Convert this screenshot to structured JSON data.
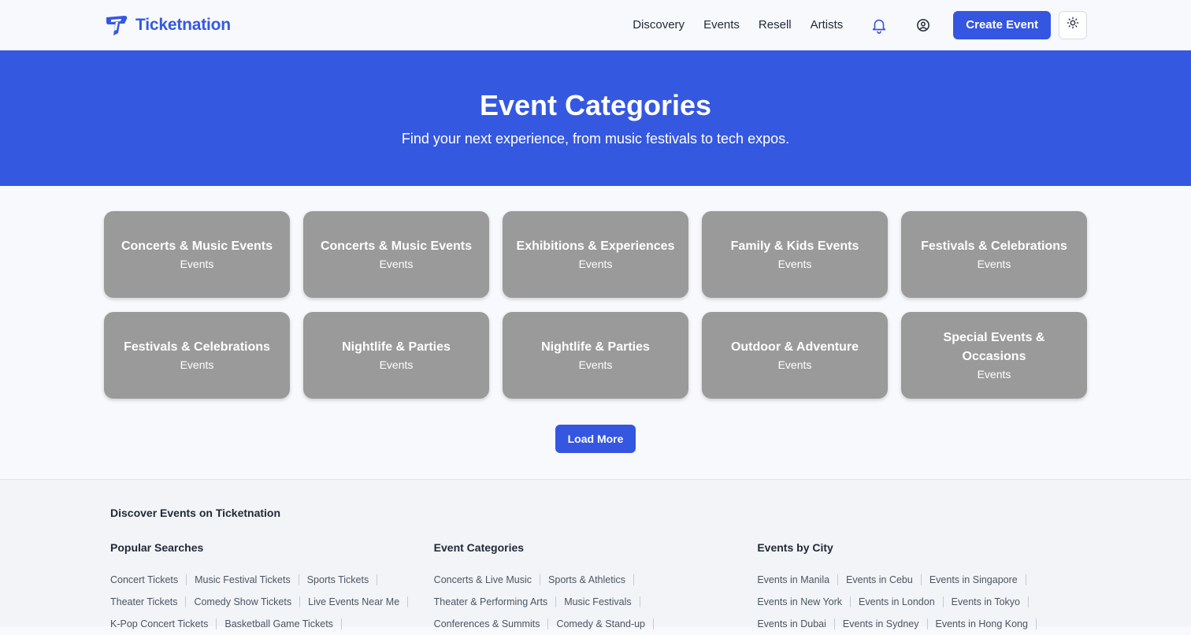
{
  "header": {
    "brand": "Ticketnation",
    "nav": [
      "Discovery",
      "Events",
      "Resell",
      "Artists"
    ],
    "create_label": "Create Event"
  },
  "hero": {
    "title": "Event Categories",
    "subtitle": "Find your next experience, from music festivals to tech expos."
  },
  "categories": [
    {
      "title": "Concerts & Music Events",
      "sub": "Events"
    },
    {
      "title": "Concerts & Music Events",
      "sub": "Events"
    },
    {
      "title": "Exhibitions & Experiences",
      "sub": "Events"
    },
    {
      "title": "Family & Kids Events",
      "sub": "Events"
    },
    {
      "title": "Festivals & Celebrations",
      "sub": "Events"
    },
    {
      "title": "Festivals & Celebrations",
      "sub": "Events"
    },
    {
      "title": "Nightlife & Parties",
      "sub": "Events"
    },
    {
      "title": "Nightlife & Parties",
      "sub": "Events"
    },
    {
      "title": "Outdoor & Adventure",
      "sub": "Events"
    },
    {
      "title": "Special Events & Occasions",
      "sub": "Events"
    }
  ],
  "load_more": "Load More",
  "footer": {
    "title": "Discover Events on Ticketnation",
    "columns": [
      {
        "heading": "Popular Searches",
        "rows": [
          [
            "Concert Tickets",
            "Music Festival Tickets",
            "Sports Tickets"
          ],
          [
            "Theater Tickets",
            "Comedy Show Tickets",
            "Live Events Near Me"
          ],
          [
            "K-Pop Concert Tickets",
            "Basketball Game Tickets"
          ]
        ]
      },
      {
        "heading": "Event Categories",
        "rows": [
          [
            "Concerts & Live Music",
            "Sports & Athletics"
          ],
          [
            "Theater & Performing Arts",
            "Music Festivals"
          ],
          [
            "Conferences & Summits",
            "Comedy & Stand-up"
          ]
        ]
      },
      {
        "heading": "Events by City",
        "rows": [
          [
            "Events in Manila",
            "Events in Cebu",
            "Events in Singapore"
          ],
          [
            "Events in New York",
            "Events in London",
            "Events in Tokyo"
          ],
          [
            "Events in Dubai",
            "Events in Sydney",
            "Events in Hong Kong"
          ]
        ]
      }
    ]
  },
  "colors": {
    "accent": "#3558e0",
    "card": "#9a9a9a"
  },
  "icons": [
    "ticketnation-logo-icon",
    "bell-icon",
    "user-circle-icon",
    "sun-icon"
  ]
}
